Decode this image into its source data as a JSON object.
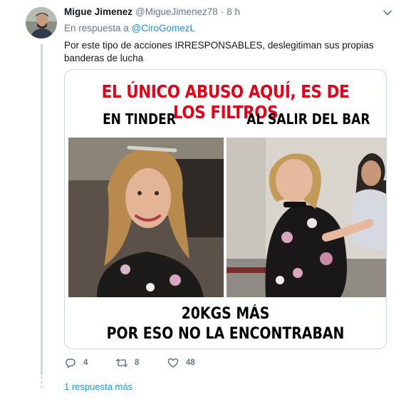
{
  "tweet": {
    "display_name": "Migue Jimenez",
    "handle": "@MigueJimenez78",
    "separator": "·",
    "time": "8 h",
    "reply_prefix": "En respuesta a",
    "reply_to": "@CiroGomezL",
    "text": "Por este tipo de acciones IRRESPONSABLES, deslegitiman sus propias banderas de lucha"
  },
  "meme": {
    "title": "EL ÚNICO ABUSO AQUÍ, ES DE LOS FILTROS",
    "left_caption": "EN TINDER",
    "right_caption": "AL SALIR DEL BAR",
    "bottom_line1": "20KGS MÁS",
    "bottom_line2": "POR ESO NO LA ENCONTRABAN",
    "title_color": "#e0001a"
  },
  "actions": {
    "reply_count": "4",
    "retweet_count": "8",
    "like_count": "48"
  },
  "more_replies": "1 respuesta más",
  "colors": {
    "link": "#1b95e0",
    "secondary_text": "#657786",
    "thread_line": "#ccd6dd"
  }
}
